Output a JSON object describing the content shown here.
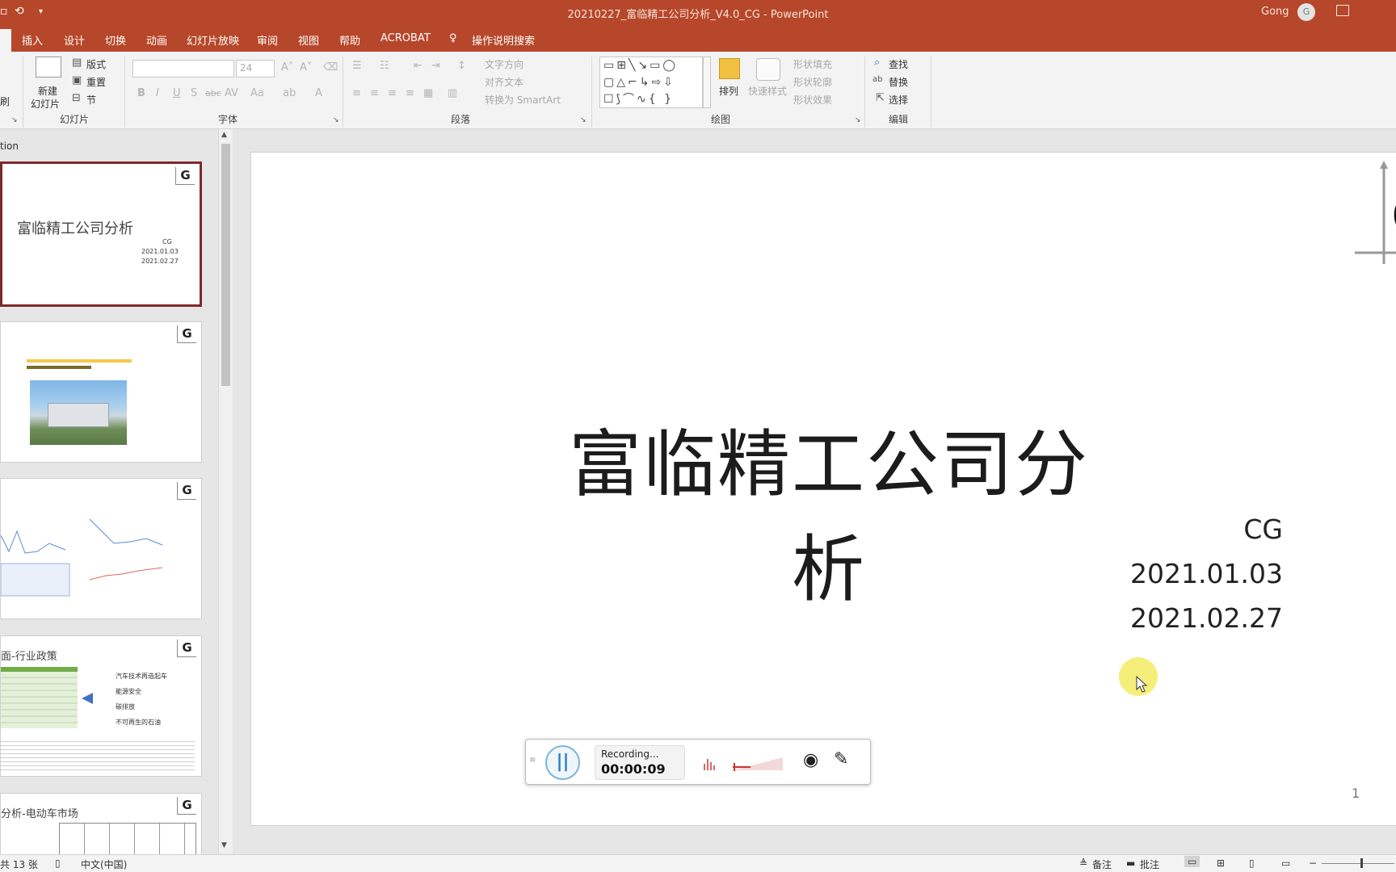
{
  "window": {
    "title": "20210227_富临精工公司分析_V4.0_CG  -  PowerPoint",
    "user_name": "Gong",
    "user_initial": "G"
  },
  "menu": {
    "tabs": [
      "插入",
      "设计",
      "切换",
      "动画",
      "幻灯片放映",
      "审阅",
      "视图",
      "帮助",
      "ACROBAT"
    ],
    "tell_me": "操作说明搜索"
  },
  "ribbon": {
    "slides_group": {
      "label": "幻灯片",
      "new_slide_line1": "新建",
      "new_slide_line2": "幻灯片",
      "layout": "版式",
      "reset": "重置",
      "section": "节",
      "partial_left": "刷"
    },
    "font_group": {
      "label": "字体",
      "font_size": "24",
      "bold": "B",
      "italic": "I",
      "underline": "U",
      "strike": "S",
      "strike2": "abc",
      "spacing": "AV",
      "case": "Aa",
      "color": "A"
    },
    "paragraph_group": {
      "label": "段落",
      "text_direction": "文字方向",
      "align_text": "对齐文本",
      "convert_smartart": "转换为 SmartArt"
    },
    "drawing_group": {
      "label": "绘图",
      "arrange": "排列",
      "quick_styles": "快速样式",
      "shape_fill": "形状填充",
      "shape_outline": "形状轮廓",
      "shape_effects": "形状效果"
    },
    "editing_group": {
      "label": "编辑",
      "find": "查找",
      "replace": "替换",
      "select": "选择"
    }
  },
  "thumbnails": {
    "pane_header": "tion",
    "slide1": {
      "title": "富临精工公司分析",
      "author": "CG",
      "date1": "2021.01.03",
      "date2": "2021.02.27"
    },
    "slide4": {
      "title": "面-行业政策",
      "bullets": [
        "汽车技术再造起车",
        "能源安全",
        "碳排放",
        "不可再生的石油"
      ]
    },
    "slide5": {
      "title": "分析-电动车市场"
    }
  },
  "slide": {
    "title": "富临精工公司分析",
    "author": "CG",
    "date1": "2021.01.03",
    "date2": "2021.02.27",
    "page_number": "1",
    "logo_letter": "G"
  },
  "recorder": {
    "status": "Recording...",
    "elapsed": "00:00:09"
  },
  "statusbar": {
    "slide_count": "共 13 张",
    "language": "中文(中国)",
    "notes": "备注",
    "comments": "批注"
  }
}
